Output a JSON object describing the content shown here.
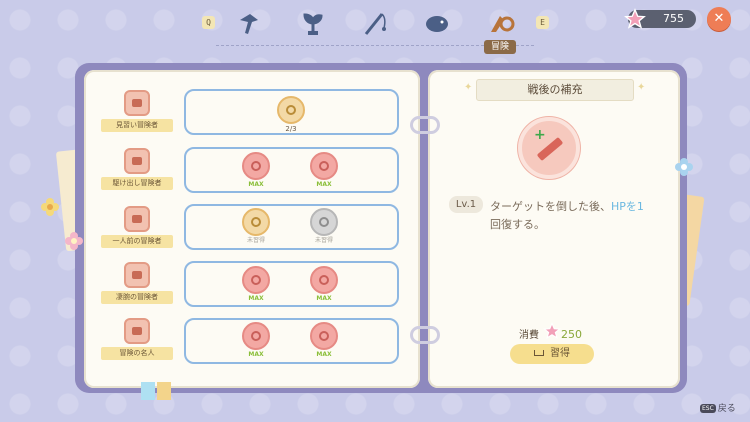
{
  "topbar": {
    "key_prev": "Q",
    "key_next": "E",
    "tabs": [
      {
        "icon": "hammer-icon"
      },
      {
        "icon": "sprout-icon"
      },
      {
        "icon": "fishing-rod-icon"
      },
      {
        "icon": "hedgehog-icon"
      },
      {
        "icon": "adventure-icon"
      }
    ],
    "active_tab_label": "冒険",
    "currency_value": "755",
    "close_label": "✕"
  },
  "ranks": [
    {
      "label": "見習い冒険者",
      "skills": [
        {
          "state": "progress",
          "tag": "2/3"
        }
      ]
    },
    {
      "label": "駆け出し冒険者",
      "skills": [
        {
          "state": "max",
          "tag": "MAX"
        },
        {
          "state": "max",
          "tag": "MAX"
        }
      ]
    },
    {
      "label": "一人前の冒険者",
      "skills": [
        {
          "state": "selected",
          "tag": "未習得"
        },
        {
          "state": "locked",
          "tag": "未習得"
        }
      ]
    },
    {
      "label": "凄腕の冒険者",
      "skills": [
        {
          "state": "max",
          "tag": "MAX"
        },
        {
          "state": "max",
          "tag": "MAX"
        }
      ]
    },
    {
      "label": "冒険の名人",
      "skills": [
        {
          "state": "max",
          "tag": "MAX"
        },
        {
          "state": "max",
          "tag": "MAX"
        }
      ]
    }
  ],
  "detail": {
    "title": "戦後の補充",
    "level": "Lv.1",
    "desc_a": "ターゲットを倒した後、",
    "desc_hl": "HPを1",
    "desc_b": "回復する。",
    "cost_label": "消費",
    "cost_value": "250",
    "learn_label": "習得"
  },
  "footer": {
    "esc_key": "ESC",
    "back_label": "戻る"
  },
  "colors": {
    "background": "#c9cbe9",
    "book": "#8e89be",
    "accent_red": "#ee7d56",
    "max_green": "#8bbf3a",
    "highlight_blue": "#6bb8e0"
  }
}
